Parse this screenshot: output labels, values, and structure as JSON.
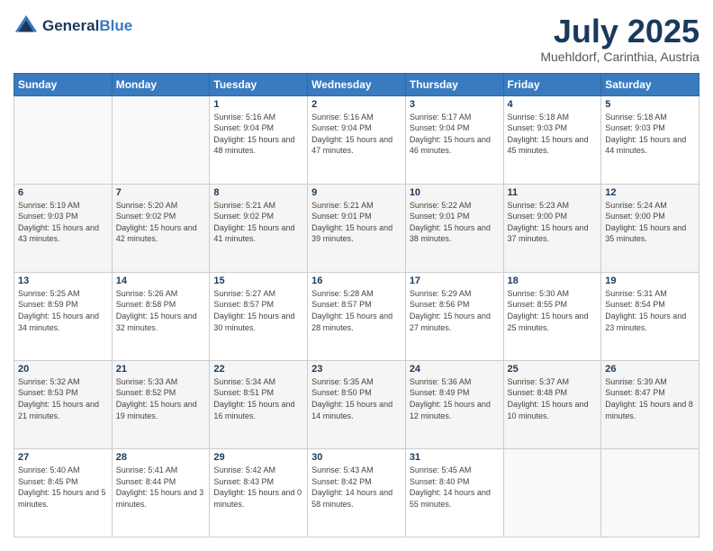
{
  "logo": {
    "line1": "General",
    "line2": "Blue"
  },
  "header": {
    "month": "July 2025",
    "location": "Muehldorf, Carinthia, Austria"
  },
  "weekdays": [
    "Sunday",
    "Monday",
    "Tuesday",
    "Wednesday",
    "Thursday",
    "Friday",
    "Saturday"
  ],
  "weeks": [
    [
      {
        "day": "",
        "sunrise": "",
        "sunset": "",
        "daylight": "",
        "empty": true
      },
      {
        "day": "",
        "sunrise": "",
        "sunset": "",
        "daylight": "",
        "empty": true
      },
      {
        "day": "1",
        "sunrise": "Sunrise: 5:16 AM",
        "sunset": "Sunset: 9:04 PM",
        "daylight": "Daylight: 15 hours and 48 minutes.",
        "empty": false
      },
      {
        "day": "2",
        "sunrise": "Sunrise: 5:16 AM",
        "sunset": "Sunset: 9:04 PM",
        "daylight": "Daylight: 15 hours and 47 minutes.",
        "empty": false
      },
      {
        "day": "3",
        "sunrise": "Sunrise: 5:17 AM",
        "sunset": "Sunset: 9:04 PM",
        "daylight": "Daylight: 15 hours and 46 minutes.",
        "empty": false
      },
      {
        "day": "4",
        "sunrise": "Sunrise: 5:18 AM",
        "sunset": "Sunset: 9:03 PM",
        "daylight": "Daylight: 15 hours and 45 minutes.",
        "empty": false
      },
      {
        "day": "5",
        "sunrise": "Sunrise: 5:18 AM",
        "sunset": "Sunset: 9:03 PM",
        "daylight": "Daylight: 15 hours and 44 minutes.",
        "empty": false
      }
    ],
    [
      {
        "day": "6",
        "sunrise": "Sunrise: 5:19 AM",
        "sunset": "Sunset: 9:03 PM",
        "daylight": "Daylight: 15 hours and 43 minutes.",
        "empty": false
      },
      {
        "day": "7",
        "sunrise": "Sunrise: 5:20 AM",
        "sunset": "Sunset: 9:02 PM",
        "daylight": "Daylight: 15 hours and 42 minutes.",
        "empty": false
      },
      {
        "day": "8",
        "sunrise": "Sunrise: 5:21 AM",
        "sunset": "Sunset: 9:02 PM",
        "daylight": "Daylight: 15 hours and 41 minutes.",
        "empty": false
      },
      {
        "day": "9",
        "sunrise": "Sunrise: 5:21 AM",
        "sunset": "Sunset: 9:01 PM",
        "daylight": "Daylight: 15 hours and 39 minutes.",
        "empty": false
      },
      {
        "day": "10",
        "sunrise": "Sunrise: 5:22 AM",
        "sunset": "Sunset: 9:01 PM",
        "daylight": "Daylight: 15 hours and 38 minutes.",
        "empty": false
      },
      {
        "day": "11",
        "sunrise": "Sunrise: 5:23 AM",
        "sunset": "Sunset: 9:00 PM",
        "daylight": "Daylight: 15 hours and 37 minutes.",
        "empty": false
      },
      {
        "day": "12",
        "sunrise": "Sunrise: 5:24 AM",
        "sunset": "Sunset: 9:00 PM",
        "daylight": "Daylight: 15 hours and 35 minutes.",
        "empty": false
      }
    ],
    [
      {
        "day": "13",
        "sunrise": "Sunrise: 5:25 AM",
        "sunset": "Sunset: 8:59 PM",
        "daylight": "Daylight: 15 hours and 34 minutes.",
        "empty": false
      },
      {
        "day": "14",
        "sunrise": "Sunrise: 5:26 AM",
        "sunset": "Sunset: 8:58 PM",
        "daylight": "Daylight: 15 hours and 32 minutes.",
        "empty": false
      },
      {
        "day": "15",
        "sunrise": "Sunrise: 5:27 AM",
        "sunset": "Sunset: 8:57 PM",
        "daylight": "Daylight: 15 hours and 30 minutes.",
        "empty": false
      },
      {
        "day": "16",
        "sunrise": "Sunrise: 5:28 AM",
        "sunset": "Sunset: 8:57 PM",
        "daylight": "Daylight: 15 hours and 28 minutes.",
        "empty": false
      },
      {
        "day": "17",
        "sunrise": "Sunrise: 5:29 AM",
        "sunset": "Sunset: 8:56 PM",
        "daylight": "Daylight: 15 hours and 27 minutes.",
        "empty": false
      },
      {
        "day": "18",
        "sunrise": "Sunrise: 5:30 AM",
        "sunset": "Sunset: 8:55 PM",
        "daylight": "Daylight: 15 hours and 25 minutes.",
        "empty": false
      },
      {
        "day": "19",
        "sunrise": "Sunrise: 5:31 AM",
        "sunset": "Sunset: 8:54 PM",
        "daylight": "Daylight: 15 hours and 23 minutes.",
        "empty": false
      }
    ],
    [
      {
        "day": "20",
        "sunrise": "Sunrise: 5:32 AM",
        "sunset": "Sunset: 8:53 PM",
        "daylight": "Daylight: 15 hours and 21 minutes.",
        "empty": false
      },
      {
        "day": "21",
        "sunrise": "Sunrise: 5:33 AM",
        "sunset": "Sunset: 8:52 PM",
        "daylight": "Daylight: 15 hours and 19 minutes.",
        "empty": false
      },
      {
        "day": "22",
        "sunrise": "Sunrise: 5:34 AM",
        "sunset": "Sunset: 8:51 PM",
        "daylight": "Daylight: 15 hours and 16 minutes.",
        "empty": false
      },
      {
        "day": "23",
        "sunrise": "Sunrise: 5:35 AM",
        "sunset": "Sunset: 8:50 PM",
        "daylight": "Daylight: 15 hours and 14 minutes.",
        "empty": false
      },
      {
        "day": "24",
        "sunrise": "Sunrise: 5:36 AM",
        "sunset": "Sunset: 8:49 PM",
        "daylight": "Daylight: 15 hours and 12 minutes.",
        "empty": false
      },
      {
        "day": "25",
        "sunrise": "Sunrise: 5:37 AM",
        "sunset": "Sunset: 8:48 PM",
        "daylight": "Daylight: 15 hours and 10 minutes.",
        "empty": false
      },
      {
        "day": "26",
        "sunrise": "Sunrise: 5:39 AM",
        "sunset": "Sunset: 8:47 PM",
        "daylight": "Daylight: 15 hours and 8 minutes.",
        "empty": false
      }
    ],
    [
      {
        "day": "27",
        "sunrise": "Sunrise: 5:40 AM",
        "sunset": "Sunset: 8:45 PM",
        "daylight": "Daylight: 15 hours and 5 minutes.",
        "empty": false
      },
      {
        "day": "28",
        "sunrise": "Sunrise: 5:41 AM",
        "sunset": "Sunset: 8:44 PM",
        "daylight": "Daylight: 15 hours and 3 minutes.",
        "empty": false
      },
      {
        "day": "29",
        "sunrise": "Sunrise: 5:42 AM",
        "sunset": "Sunset: 8:43 PM",
        "daylight": "Daylight: 15 hours and 0 minutes.",
        "empty": false
      },
      {
        "day": "30",
        "sunrise": "Sunrise: 5:43 AM",
        "sunset": "Sunset: 8:42 PM",
        "daylight": "Daylight: 14 hours and 58 minutes.",
        "empty": false
      },
      {
        "day": "31",
        "sunrise": "Sunrise: 5:45 AM",
        "sunset": "Sunset: 8:40 PM",
        "daylight": "Daylight: 14 hours and 55 minutes.",
        "empty": false
      },
      {
        "day": "",
        "sunrise": "",
        "sunset": "",
        "daylight": "",
        "empty": true
      },
      {
        "day": "",
        "sunrise": "",
        "sunset": "",
        "daylight": "",
        "empty": true
      }
    ]
  ]
}
